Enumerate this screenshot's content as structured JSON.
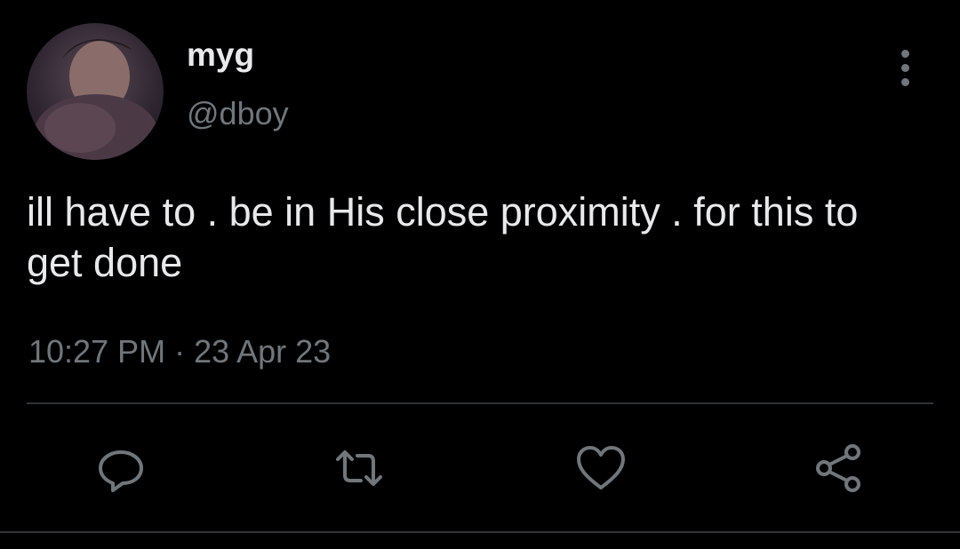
{
  "tweet": {
    "display_name": "myg",
    "handle": "@dboy",
    "text": "ill have to . be in His close proximity . for this to get done",
    "timestamp": "10:27 PM · 23 Apr 23"
  },
  "icons": {
    "more": "more-vertical-icon",
    "reply": "reply-icon",
    "retweet": "retweet-icon",
    "like": "heart-icon",
    "share": "share-icon"
  },
  "colors": {
    "background": "#000000",
    "primary_text": "#e7e9ea",
    "secondary_text": "#71767b",
    "divider": "#2f3336"
  }
}
